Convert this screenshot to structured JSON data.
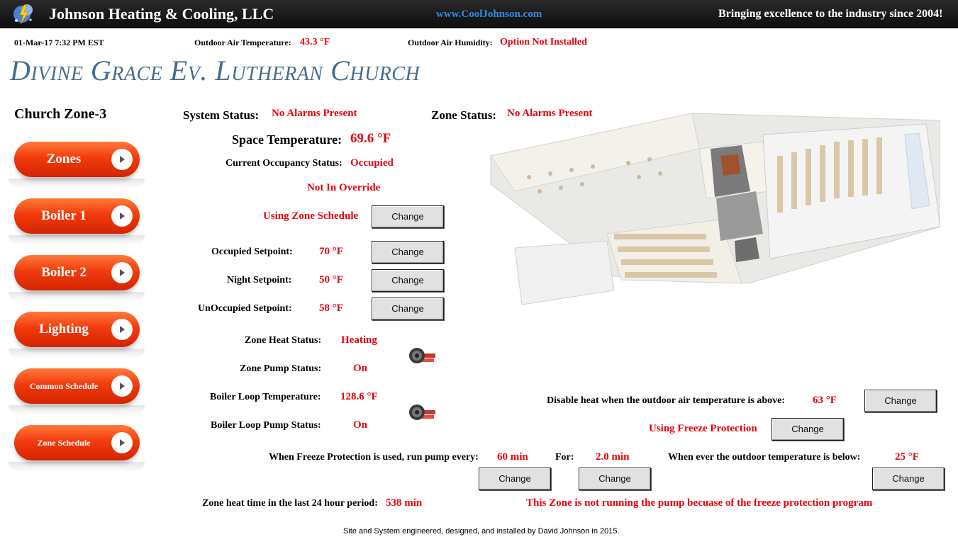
{
  "header": {
    "company": "Johnson Heating & Cooling, LLC",
    "website": "www.CoolJohnson.com",
    "tagline": "Bringing excellence to the industry since 2004!"
  },
  "info_bar": {
    "datetime": "01-Mar-17 7:32 PM EST",
    "outdoor_temp_label": "Outdoor Air Temperature:",
    "outdoor_temp_value": "43.3 °F",
    "outdoor_humidity_label": "Outdoor Air Humidity:",
    "outdoor_humidity_value": "Option Not Installed"
  },
  "church_name": "Divine Grace Ev. Lutheran Church",
  "zone_title": "Church Zone-3",
  "nav": [
    "Zones",
    "Boiler 1",
    "Boiler 2",
    "Lighting",
    "Common Schedule",
    "Zone Schedule"
  ],
  "status": {
    "system_label": "System Status:",
    "system_value": "No Alarms Present",
    "zone_label": "Zone Status:",
    "zone_value": "No Alarms Present",
    "space_temp_label": "Space Temperature:",
    "space_temp_value": "69.6 °F",
    "occupancy_label": "Current Occupancy Status:",
    "occupancy_value": "Occupied",
    "override": "Not In Override",
    "schedule": "Using Zone Schedule"
  },
  "setpoints": {
    "occupied_label": "Occupied Setpoint:",
    "occupied_value": "70 °F",
    "night_label": "Night Setpoint:",
    "night_value": "50 °F",
    "unoccupied_label": "UnOccupied Setpoint:",
    "unoccupied_value": "58 °F"
  },
  "heat": {
    "zone_heat_label": "Zone Heat Status:",
    "zone_heat_value": "Heating",
    "zone_pump_label": "Zone Pump Status:",
    "zone_pump_value": "On",
    "boiler_loop_temp_label": "Boiler Loop Temperature:",
    "boiler_loop_temp_value": "128.6 °F",
    "boiler_loop_pump_label": "Boiler Loop Pump Status:",
    "boiler_loop_pump_value": "On"
  },
  "freeze": {
    "disable_label": "Disable heat when the outdoor air temperature is above:",
    "disable_value": "63 °F",
    "using_label": "Using Freeze Protection",
    "run_label": "When Freeze Protection is used, run pump every:",
    "run_value": "60 min",
    "for_label": "For:",
    "for_value": "2.0 min",
    "below_label": "When ever the outdoor temperature is below:",
    "below_value": "25 °F",
    "heat_time_label": "Zone heat time in the last 24 hour period:",
    "heat_time_value": "538 min",
    "message": "This Zone is not running the pump becuase of the freeze protection program"
  },
  "change_label": "Change",
  "footer": "Site and System engineered, designed, and installed by David Johnson in 2015.",
  "colors": {
    "accent_red": "#e8000b",
    "title_blue": "#466d8f",
    "nav_orange": "#f23b0d",
    "link_blue": "#2f8fe8"
  },
  "icons": [
    "logo-icon",
    "chevron-right-icon",
    "pump-icon",
    "floorplan-image"
  ]
}
